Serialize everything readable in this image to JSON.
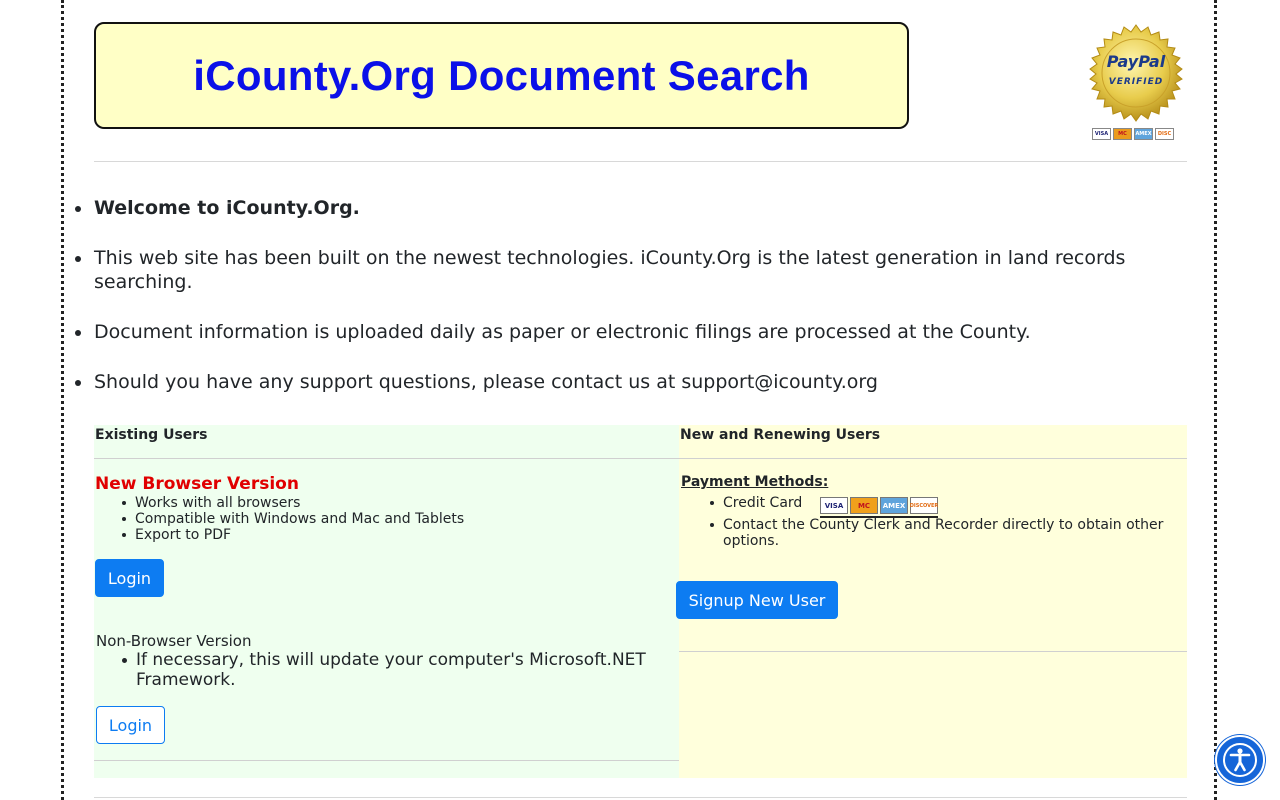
{
  "header": {
    "title": "iCounty.Org Document Search",
    "paypal_brand": "PayPal",
    "paypal_verified": "VERIFIED",
    "mini_cards": [
      "VISA",
      "MC",
      "AMEX",
      "DISC"
    ]
  },
  "intro": {
    "items": [
      "Welcome to iCounty.Org.",
      "This web site has been built on the newest technologies. iCounty.Org is the latest generation in land records searching.",
      "Document information is uploaded daily as paper or electronic filings are processed at the County.",
      "Should you have any support questions, please contact us at support@icounty.org"
    ]
  },
  "existing_users": {
    "heading": "Existing Users",
    "new_browser_title": "New Browser Version",
    "features": [
      "Works with all browsers",
      "Compatible with Windows and Mac and Tablets",
      "Export to PDF"
    ],
    "login_label": "Login",
    "non_browser_title": "Non-Browser Version",
    "non_browser_notes": [
      "If necessary, this will update your computer's Microsoft.NET Framework."
    ],
    "login2_label": "Login"
  },
  "new_users": {
    "heading": "New and Renewing Users",
    "payment_heading": "Payment Methods:",
    "payment_methods": [
      "Credit Card",
      "Contact the County Clerk and Recorder directly to obtain other options."
    ],
    "cards": [
      "VISA",
      "MC",
      "AMEX",
      "DISCOVER"
    ],
    "signup_label": "Signup New User"
  },
  "colors": {
    "banner_bg": "#ffffc6",
    "banner_text": "#0b10e8",
    "left_panel_bg": "#efffef",
    "right_panel_bg": "#ffffdc",
    "accent": "#0d7cf2",
    "highlight": "#e00000"
  },
  "icons": {
    "accessibility": "accessibility-icon"
  }
}
